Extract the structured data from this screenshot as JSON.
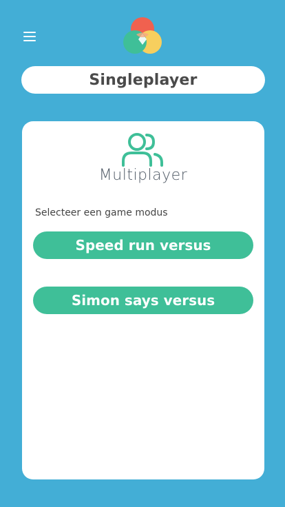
{
  "header": {
    "menu_icon": "hamburger-menu-icon",
    "logo_icon": "color-circles-logo"
  },
  "singleplayer_button": {
    "label": "Singleplayer"
  },
  "card": {
    "icon": "users-group-icon",
    "title": "Multiplayer",
    "subtitle": "Selecteer een game modus",
    "modes": [
      {
        "label": "Speed run versus"
      },
      {
        "label": "Simon says versus"
      }
    ]
  },
  "colors": {
    "background": "#43aed6",
    "accent": "#3fbf98",
    "logo_red": "#f0614f",
    "logo_yellow": "#f7cf5e",
    "logo_green": "#3fbf98"
  }
}
